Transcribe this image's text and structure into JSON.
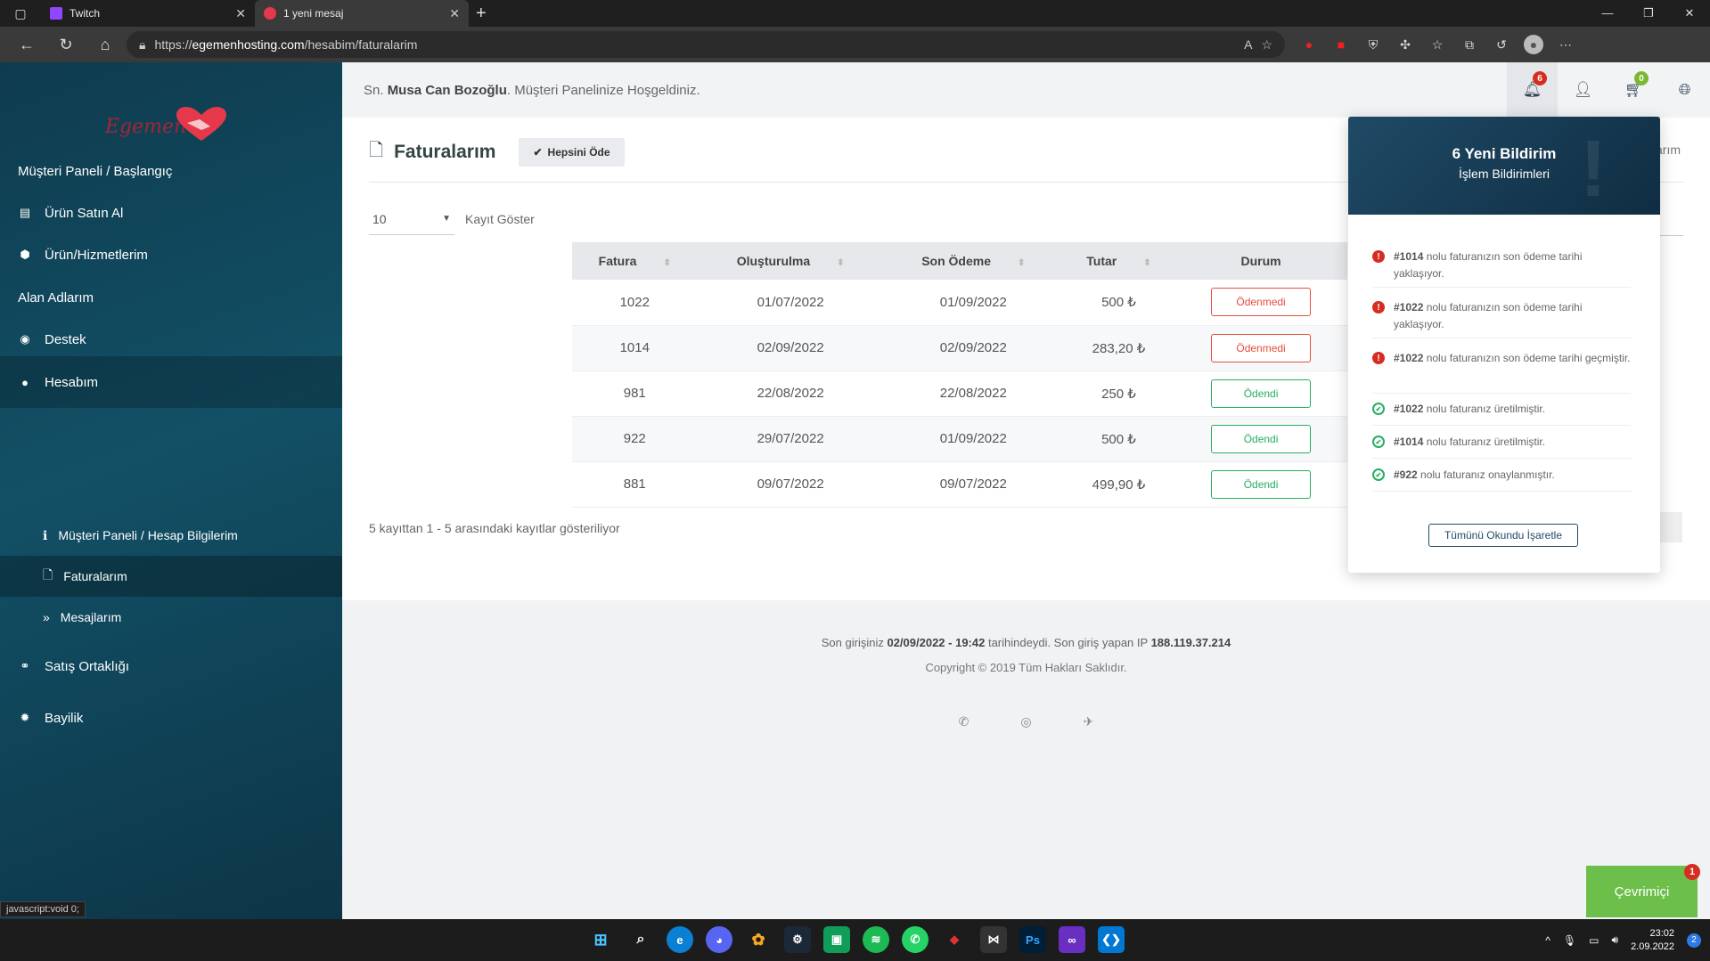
{
  "browser": {
    "tabs": [
      {
        "label": "Twitch",
        "active": false
      },
      {
        "label": "1 yeni mesaj",
        "active": true
      }
    ],
    "url_prefix": "https://",
    "url_host": "egemenhosting.com",
    "url_path": "/hesabim/faturalarim",
    "status_text": "javascript:void 0;"
  },
  "sidebar": {
    "logo_text": "Egemen",
    "items": [
      {
        "label": "Müşteri Paneli / Başlangıç",
        "icon": "none"
      },
      {
        "label": "Ürün Satın Al",
        "icon": "list-icon"
      },
      {
        "label": "Ürün/Hizmetlerim",
        "icon": "cube-icon"
      },
      {
        "label": "Alan Adlarım",
        "icon": "none"
      },
      {
        "label": "Destek",
        "icon": "lifebuoy-icon"
      },
      {
        "label": "Hesabım",
        "icon": "user-icon"
      },
      {
        "label": "Satış Ortaklığı",
        "icon": "handshake-icon"
      },
      {
        "label": "Bayilik",
        "icon": "cog-icon"
      }
    ],
    "subitems": [
      {
        "label": "Müşteri Paneli / Hesap Bilgilerim",
        "icon": "info-icon"
      },
      {
        "label": "Faturalarım",
        "icon": "document-icon"
      },
      {
        "label": "Mesajlarım",
        "icon": "double-chevron-icon"
      }
    ]
  },
  "topbar": {
    "greeting_prefix": "Sn.",
    "user_name": "Musa Can Bozoğlu",
    "greeting_suffix": ". Müşteri Panelinize Hoşgeldiniz.",
    "notification_count": "6",
    "cart_count": "0"
  },
  "page": {
    "title": "Faturalarım",
    "pay_all_label": "Hepsini Öde",
    "page_size": "10",
    "page_size_label": "Kayıt Göster",
    "right_label": "arım",
    "table_info": "5 kayıttan 1 - 5 arasındaki kayıtlar gösteriliyor"
  },
  "table": {
    "headers": [
      "Fatura",
      "Oluşturulma",
      "Son Ödeme",
      "Tutar",
      "Durum"
    ],
    "rows": [
      {
        "id": "1022",
        "created": "01/07/2022",
        "due": "01/09/2022",
        "amount": "500 ₺",
        "status": "Ödenmedi",
        "paid": false
      },
      {
        "id": "1014",
        "created": "02/09/2022",
        "due": "02/09/2022",
        "amount": "283,20 ₺",
        "status": "Ödenmedi",
        "paid": false
      },
      {
        "id": "981",
        "created": "22/08/2022",
        "due": "22/08/2022",
        "amount": "250 ₺",
        "status": "Ödendi",
        "paid": true
      },
      {
        "id": "922",
        "created": "29/07/2022",
        "due": "01/09/2022",
        "amount": "500 ₺",
        "status": "Ödendi",
        "paid": true
      },
      {
        "id": "881",
        "created": "09/07/2022",
        "due": "09/07/2022",
        "amount": "499,90 ₺",
        "status": "Ödendi",
        "paid": true
      }
    ]
  },
  "footer": {
    "last_login_prefix": "Son girişiniz",
    "last_login_time": "02/09/2022 - 19:42",
    "last_login_mid": "tarihindeydi. Son giriş yapan IP",
    "last_login_ip": "188.119.37.214",
    "copyright": "Copyright © 2019 Tüm Hakları Saklıdır."
  },
  "notifications": {
    "title": "6 Yeni Bildirim",
    "subtitle": "İşlem Bildirimleri",
    "items": [
      {
        "ref": "#1014",
        "text": " nolu faturanızın son ödeme tarihi yaklaşıyor.",
        "kind": "warn"
      },
      {
        "ref": "#1022",
        "text": " nolu faturanızın son ödeme tarihi yaklaşıyor.",
        "kind": "warn"
      },
      {
        "ref": "#1022",
        "text": " nolu faturanızın son ödeme tarihi geçmiştir.",
        "kind": "warn"
      },
      {
        "ref": "#1022",
        "text": " nolu faturanız üretilmiştir.",
        "kind": "ok"
      },
      {
        "ref": "#1014",
        "text": " nolu faturanız üretilmiştir.",
        "kind": "ok"
      },
      {
        "ref": "#922",
        "text": " nolu faturanız onaylanmıştır.",
        "kind": "ok"
      }
    ],
    "mark_all_label": "Tümünü Okundu İşaretle"
  },
  "chat": {
    "label": "Çevrimiçi",
    "badge": "1"
  },
  "taskbar": {
    "time": "23:02",
    "date": "2.09.2022",
    "tray_badge": "2"
  },
  "colors": {
    "sidebar_bg": "#125066",
    "accent_red": "#e74c3c",
    "accent_green": "#27ae60",
    "online_green": "#6cbf4a"
  }
}
